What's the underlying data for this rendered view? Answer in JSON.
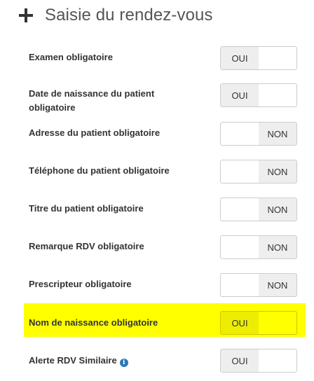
{
  "header": {
    "title": "Saisie du rendez-vous",
    "icon": "plus-icon"
  },
  "settings": [
    {
      "label": "Examen obligatoire",
      "value": "OUI"
    },
    {
      "label": "Date de naissance du patient obligatoire",
      "value": "OUI"
    },
    {
      "label": "Adresse du patient obligatoire",
      "value": "NON"
    },
    {
      "label": "Téléphone du patient obligatoire",
      "value": "NON"
    },
    {
      "label": "Titre du patient obligatoire",
      "value": "NON"
    },
    {
      "label": "Remarque RDV obligatoire",
      "value": "NON"
    },
    {
      "label": "Prescripteur obligatoire",
      "value": "NON"
    },
    {
      "label": "Nom de naissance obligatoire",
      "value": "OUI",
      "highlighted": true
    },
    {
      "label": "Alerte RDV Similaire",
      "value": "OUI",
      "info_icon": "info-icon"
    }
  ],
  "colors": {
    "highlight": "#ffff00",
    "toggle_active_bg": "#eeeeee",
    "info_icon": "#2a7ab8"
  }
}
